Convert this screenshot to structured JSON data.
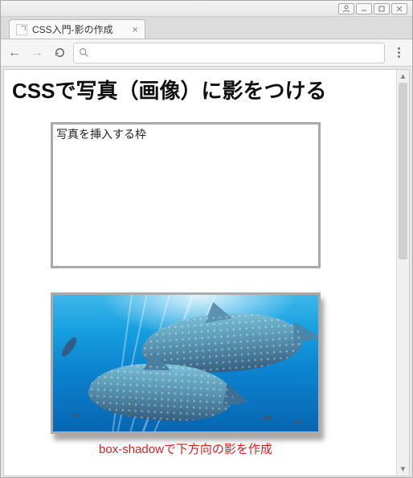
{
  "window": {
    "controls": {
      "user": "user",
      "min": "minimize",
      "max": "maximize",
      "close": "close"
    }
  },
  "tab": {
    "title": "CSS入門-影の作成",
    "favicon": "doc-icon",
    "close_label": "×"
  },
  "toolbar": {
    "back": "←",
    "forward": "→",
    "reload": "⟳",
    "omnibox_icon": "search-icon",
    "omnibox_value": "",
    "menu": "menu"
  },
  "page": {
    "heading": "CSSで写真（画像）に影をつける",
    "frame_text": "写真を挿入する枠",
    "image_alt": "水族館のジンベエザメ",
    "caption": "box-shadowで下方向の影を作成"
  }
}
